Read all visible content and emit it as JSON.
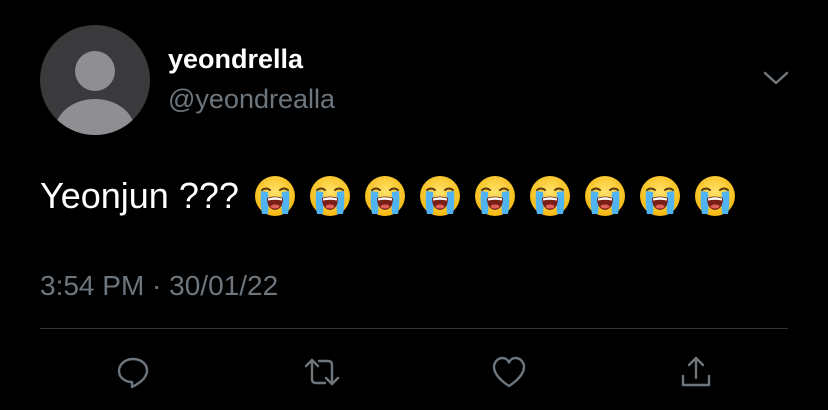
{
  "tweet": {
    "author": {
      "display_name": "yeondrella",
      "handle": "@yeondrealla",
      "avatar_icon": "default-profile-icon"
    },
    "text": "Yeonjun ???",
    "emoji": {
      "name": "loudly-crying-face",
      "count": 9
    },
    "timestamp": "3:54 PM · 30/01/22"
  },
  "actions": [
    {
      "name": "reply",
      "icon": "speech-bubble-icon"
    },
    {
      "name": "retweet",
      "icon": "retweet-arrows-icon"
    },
    {
      "name": "like",
      "icon": "heart-icon"
    },
    {
      "name": "share",
      "icon": "share-upload-icon"
    }
  ],
  "colors": {
    "background": "#000000",
    "primary_text": "#ffffff",
    "secondary_text": "#6e767d",
    "divider": "#2f3336",
    "avatar_bg": "#3a3a3c",
    "avatar_fg": "#8e8e93"
  }
}
